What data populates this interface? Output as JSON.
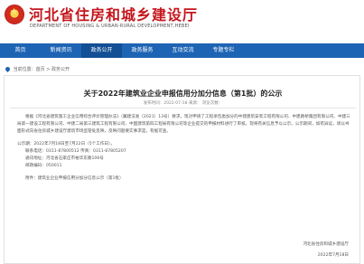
{
  "header": {
    "title": "河北省住房和城乡建设厅",
    "subtitle": "DEPARTMENT OF HOUSING & URBAN-RURAL DEVELOPMENT,HEBEI"
  },
  "nav": {
    "items": [
      "首页",
      "新闻资讯",
      "政务公开",
      "政务服务",
      "互动交流",
      "专题专栏"
    ]
  },
  "breadcrumb": "当前位置：首页 > 政务公开",
  "article": {
    "title": "关于2022年建筑业企业申报信用分加分信息（第1批）的公示",
    "meta": "发布时间：2022-07-18    来源：    浏览次数：",
    "paragraphs": [
      "根据《河北省建筑施工企业信用综合评价管理办法》（冀建法发〔2021〕13号）要求，现对申请了工程承包类加分的中建建筑安装工程有限公司、中建路桥集团有限公司、中建三局第一建设工程有限公司、中建二局第三建筑工程有限公司、中国建筑第四工程局有限公司等企业提交的申报材料进行了审核，现将有关信息予以公示。公示期间，如有异议，请以书面形式向省住房城乡建设厅建筑市场监管处反映，反映问题要实事求是，有据可查。",
      "公示期：2022年7月18日至7月22日（5个工作日）。",
      "联系电话：0311-87800512  传真：0311-87805207",
      "通讯地址：河北省石家庄市裕华东路106号",
      "邮政编码：050011"
    ],
    "attachment": "附件：建筑业企业申报信用分加分信息公示（第1批）",
    "sign_org": "河北省住房和城乡建设厅",
    "sign_date": "2022年7月18日"
  }
}
